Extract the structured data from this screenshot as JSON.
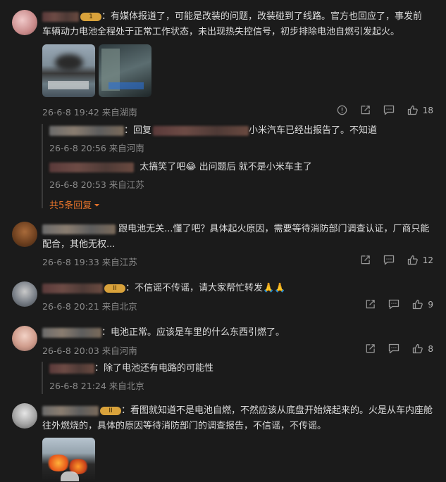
{
  "comments": [
    {
      "text_line1": "：有媒体报道了，可能是改装的问题，改装碰到了线路。官方也回应了，事发前",
      "text_line2": "车辆动力电池全程处于正常工作状态，未出现热失控信号，初步排除电池自燃引发起火。",
      "badge": "1",
      "meta": "26-6-8 19:42 来自湖南",
      "likes": "18",
      "replies": [
        {
          "prefix": "：回复",
          "text": "小米汽车已经出报告了。不知道",
          "meta": "26-6-8 20:56 来自河南"
        },
        {
          "text": "太搞笑了吧😂  出问题后 就不是小米车主了",
          "meta": "26-6-8 20:53 来自江苏"
        }
      ],
      "more_replies": "共5条回复"
    },
    {
      "text_line1": "跟电池无关...懂了吧？具体起火原因，需要等待消防部门调查认证，厂商只能",
      "text_line2": "配合，其他无权...",
      "meta": "26-6-8 19:33 来自江苏",
      "likes": "12"
    },
    {
      "text_line1": "：不信谣不传谣，请大家帮忙转发🙏🙏",
      "badge": "II",
      "meta": "26-6-8 20:21 来自北京",
      "likes": "9"
    },
    {
      "text_line1": "：电池正常。应该是车里的什么东西引燃了。",
      "meta": "26-6-8 20:03 来自河南",
      "likes": "8",
      "replies": [
        {
          "text": "：除了电池还有电路的可能性",
          "meta": "26-6-8 21:24 来自北京"
        }
      ]
    },
    {
      "text_line1": "：看图就知道不是电池自燃，不然应该从底盘开始烧起来的。火是从车内座舱",
      "text_line2": "往外燃烧的，具体的原因等待消防部门的调查报告，不信谣，不传谣。",
      "badge": "II"
    }
  ],
  "colors": {
    "background": "#1b1b1b",
    "text": "#dcdcdc",
    "meta": "#8a8a8a",
    "accent": "#e8742b",
    "badge": "#d9a23b"
  },
  "icons": [
    "report-icon",
    "share-icon",
    "comment-icon",
    "like-icon",
    "chevron-down-icon"
  ]
}
